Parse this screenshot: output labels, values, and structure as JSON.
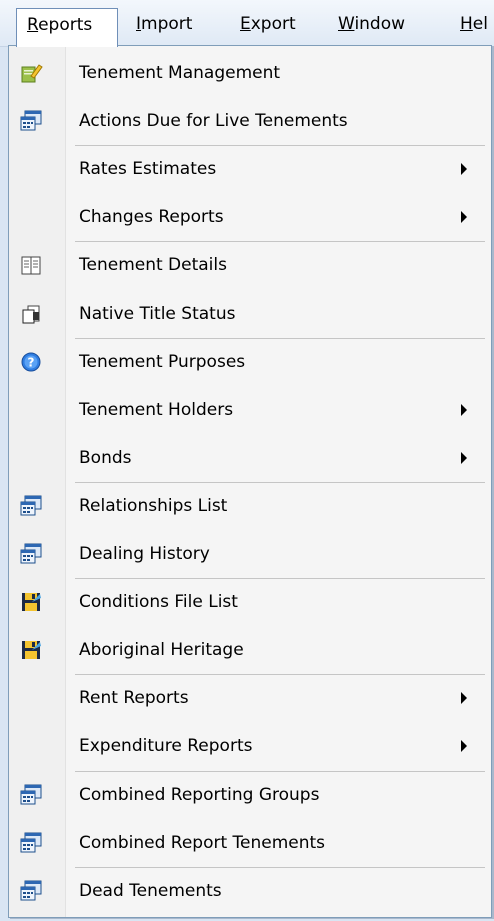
{
  "menubar": {
    "items": [
      {
        "label": "Reports",
        "mnemonic_index": 0
      },
      {
        "label": "Import",
        "mnemonic_index": 0
      },
      {
        "label": "Export",
        "mnemonic_index": 0
      },
      {
        "label": "Window",
        "mnemonic_index": 0
      },
      {
        "label": "Hel",
        "mnemonic_index": 0
      }
    ]
  },
  "menu": {
    "items": [
      {
        "label": "Tenement Management",
        "icon": "notepad-pencil-icon",
        "submenu": false
      },
      {
        "label": "Actions Due for Live Tenements",
        "icon": "report-window-icon",
        "submenu": false
      },
      {
        "label": "Rates Estimates",
        "icon": "",
        "submenu": true
      },
      {
        "label": "Changes Reports",
        "icon": "",
        "submenu": true
      },
      {
        "label": "Tenement Details",
        "icon": "two-column-grid-icon",
        "submenu": false
      },
      {
        "label": "Native Title Status",
        "icon": "document-stack-icon",
        "submenu": false
      },
      {
        "label": "Tenement Purposes",
        "icon": "help-circle-icon",
        "submenu": false
      },
      {
        "label": "Tenement Holders",
        "icon": "",
        "submenu": true
      },
      {
        "label": "Bonds",
        "icon": "",
        "submenu": true
      },
      {
        "label": "Relationships List",
        "icon": "report-window-icon",
        "submenu": false
      },
      {
        "label": "Dealing History",
        "icon": "report-window-icon",
        "submenu": false
      },
      {
        "label": "Conditions File List",
        "icon": "save-disk-icon",
        "submenu": false
      },
      {
        "label": "Aboriginal Heritage",
        "icon": "save-disk-icon",
        "submenu": false
      },
      {
        "label": "Rent Reports",
        "icon": "",
        "submenu": true
      },
      {
        "label": "Expenditure Reports",
        "icon": "",
        "submenu": true
      },
      {
        "label": "Combined Reporting Groups",
        "icon": "report-window-icon",
        "submenu": false
      },
      {
        "label": "Combined Report Tenements",
        "icon": "report-window-icon",
        "submenu": false
      },
      {
        "label": "Dead Tenements",
        "icon": "report-window-icon",
        "submenu": false
      }
    ]
  },
  "colors": {
    "menubar_bg": "#e4edf8",
    "menu_bg": "#f5f5f5",
    "separator": "#c5c5c5",
    "frame_border": "#7f9db9"
  }
}
